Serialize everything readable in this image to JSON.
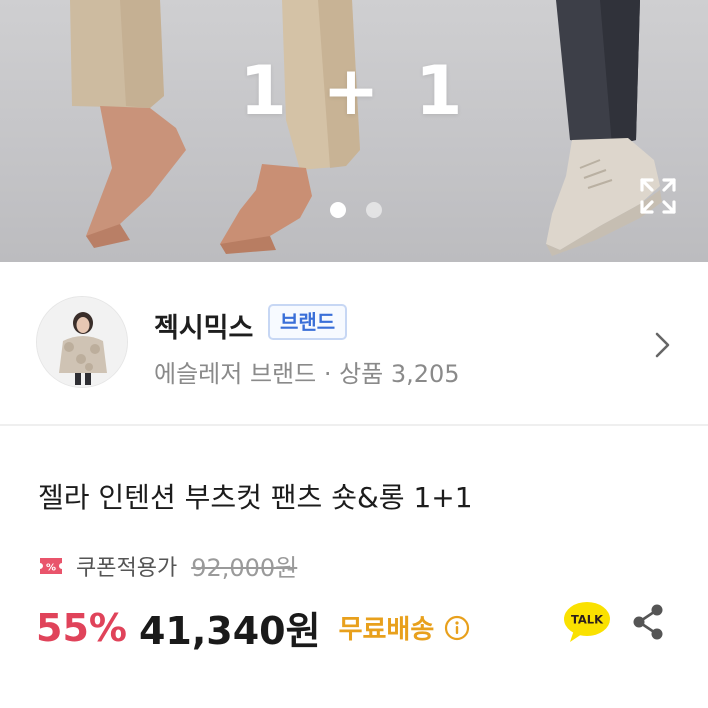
{
  "hero": {
    "promo_text": "1 + 1",
    "slide_count": 2,
    "active_slide": 1
  },
  "seller": {
    "name": "젝시믹스",
    "badge": "브랜드",
    "subtitle": "에슬레저 브랜드 · 상품 3,205"
  },
  "product": {
    "title": "젤라 인텐션 부츠컷 팬츠 숏&롱 1+1",
    "coupon_label": "쿠폰적용가",
    "original_price": "92,000원",
    "discount": "55%",
    "price": "41,340원",
    "shipping": "무료배송"
  },
  "actions": {
    "talk_label": "TALK"
  },
  "icons": [
    "expand-icon",
    "chevron-right-icon",
    "coupon-icon",
    "info-icon",
    "kakao-talk-icon",
    "share-icon"
  ],
  "colors": {
    "discount": "#e0435a",
    "shipping": "#e8a01c",
    "badge": "#3a6fd8",
    "talk_bg": "#fae100"
  }
}
